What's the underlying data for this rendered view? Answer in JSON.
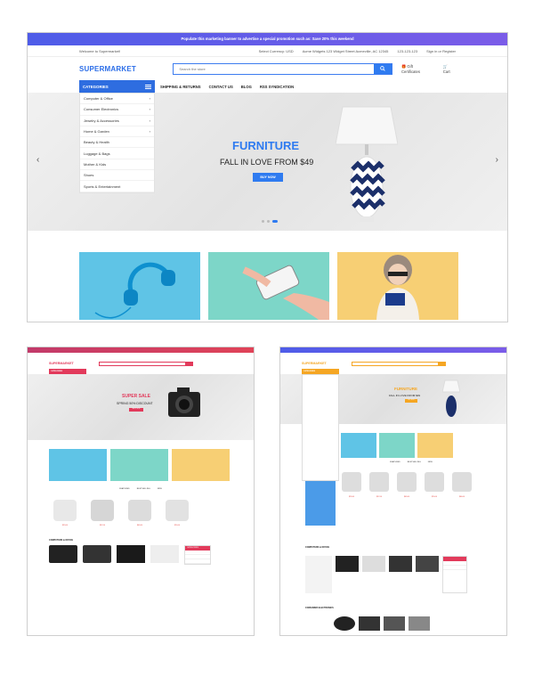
{
  "colors": {
    "primary": "#2e6de0",
    "accent_red": "#e23a5b",
    "accent_orange": "#f5a623",
    "promo_gradient": [
      "#4e5ce8",
      "#7b5ce8"
    ]
  },
  "main": {
    "promo": "Populate this marketing banner to advertise a special promotion such as: Save 20% this weekend",
    "welcome": "Welcome to Supermarket!",
    "currency": "Select Currency: USD",
    "address": "Acme Widgets 123 Widget Street Acmeville, AC 12345",
    "phone": "123-123-123",
    "signin": "Sign in or Register",
    "logo": "SUPERMARKET",
    "search_placeholder": "Search the store",
    "gift": "Gift Certificates",
    "cart": "Cart",
    "categories_label": "CATEGORIES",
    "nav": [
      "SHIPPING & RETURNS",
      "CONTACT US",
      "BLOG",
      "RSS SYNDICATION"
    ],
    "categories": [
      "Computer & Office",
      "Consumer Electronics",
      "Jewelry & Accessories",
      "Home & Garden",
      "Beauty & Health",
      "Luggage & Bags",
      "Mother & Kids",
      "Shoes",
      "Sports & Entertainment"
    ],
    "hero_title": "FURNITURE",
    "hero_subtitle": "FALL IN LOVE FROM $49",
    "hero_button": "BUY NOW"
  },
  "left": {
    "logo": "SUPERMARKET",
    "categories_label": "CATEGORIES",
    "hero_title": "SUPER SALE",
    "hero_subtitle": "SPRING 50% DISCOUNT",
    "hero_button": "SHOP NOW",
    "tabs": [
      "FEATURED",
      "BESTSELLING",
      "NEW"
    ],
    "section": "COMPUTERS & OFFICE",
    "sidebar_head": "CATEGORIES",
    "prices": [
      "$29.00",
      "$57.00",
      "$49.00",
      "$74.00"
    ]
  },
  "right": {
    "logo": "SUPERMARKET",
    "categories_label": "CATEGORIES",
    "hero_title": "FURNITURE",
    "hero_subtitle": "FALL IN LOVE FROM $49",
    "hero_button": "BUY NOW",
    "tabs": [
      "FEATURED",
      "BESTSELLING",
      "NEW"
    ],
    "section1": "COMPUTERS & OFFICE",
    "section2": "CONSUMER ELECTRONICS",
    "phone": "1900-700-800",
    "prices": [
      "$29.00",
      "$57.00",
      "$49.00",
      "$74.00",
      "$66.00"
    ]
  }
}
